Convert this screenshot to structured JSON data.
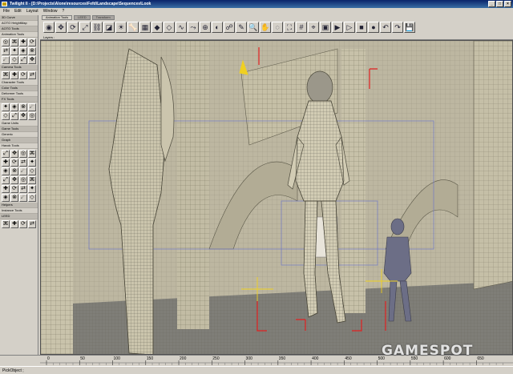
{
  "window": {
    "title": "Twilight II - [D:\\Projects\\Alone\\resources\\Fefd\\Landscape\\Sequences\\Look",
    "buttons": [
      "_",
      "□",
      "×"
    ]
  },
  "menu": [
    "File",
    "Edit",
    "Layout",
    "Window",
    "?"
  ],
  "tabs": [
    "Animation Tools",
    "LEED",
    "Transform"
  ],
  "toolbar": {
    "icons": [
      "select-icon",
      "move-icon",
      "rotate-icon",
      "scale-icon",
      "link-icon",
      "camera-icon",
      "light-icon",
      "bone-icon",
      "mesh-icon",
      "key-icon",
      "keyframe-icon",
      "curve-icon",
      "path-icon",
      "ik-icon",
      "morph-icon",
      "skin-icon",
      "paint-icon",
      "zoom-icon",
      "pan-icon",
      "orbit-icon",
      "fit-icon",
      "grid-icon",
      "snap-icon",
      "render-icon",
      "preview-icon",
      "play-icon",
      "stop-icon",
      "record-icon",
      "undo-icon",
      "redo-icon",
      "save-icon"
    ]
  },
  "left_panel": {
    "sections": [
      {
        "label": "3D Curve",
        "icons": 0
      },
      {
        "label": "AOTO HeightMap",
        "icons": 0
      },
      {
        "label": "AOTO Tools",
        "icons": 0
      },
      {
        "label": "Animation Tools",
        "icons": 12
      },
      {
        "label": "Camera Tools",
        "icons": 4
      },
      {
        "label": "Character Tools",
        "icons": 0
      },
      {
        "label": "Color Tools",
        "icons": 0
      },
      {
        "label": "Deformer Tools",
        "icons": 0
      },
      {
        "label": "FX Tools",
        "icons": 8
      },
      {
        "label": "Game Units",
        "icons": 0
      },
      {
        "label": "Game Tools",
        "icons": 0
      },
      {
        "label": "Generic",
        "icons": 0
      },
      {
        "label": "Graph",
        "icons": 0
      },
      {
        "label": "Havok Tools",
        "icons": 24
      },
      {
        "label": "Helpers",
        "icons": 0
      },
      {
        "label": "Instance Tools",
        "icons": 0
      },
      {
        "label": "LEED",
        "icons": 4
      }
    ]
  },
  "layers_label": "Layers :",
  "timeline": {
    "ticks": [
      "0",
      "50",
      "100",
      "150",
      "200",
      "250",
      "300",
      "350",
      "400",
      "450",
      "500",
      "550",
      "600",
      "650"
    ]
  },
  "status": "PickObject ;",
  "watermark": "GAMESPOT",
  "colors": {
    "viewport_bg": "#bab49e",
    "marker_red": "#e02020",
    "marker_yellow": "#f0d020",
    "wire_blue": "#6a74c8"
  }
}
